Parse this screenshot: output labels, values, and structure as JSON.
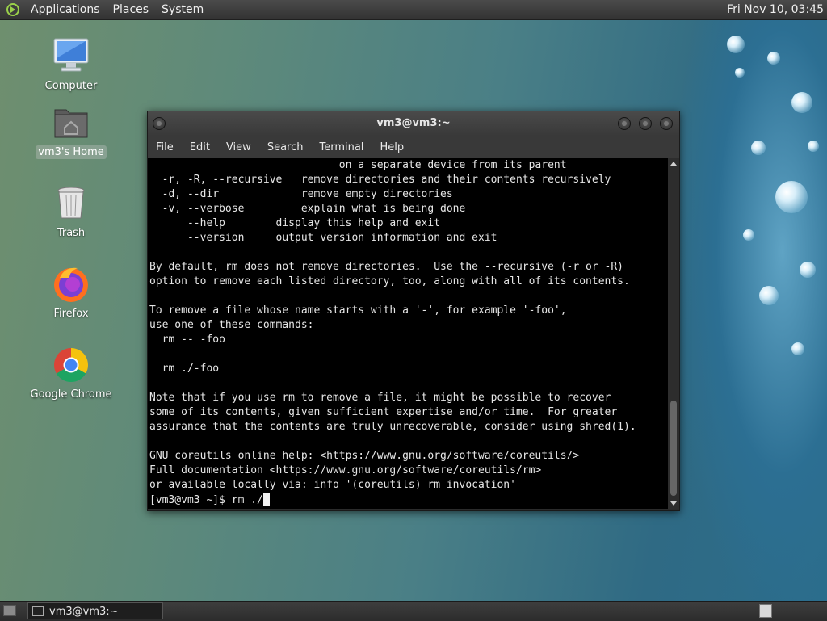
{
  "top_panel": {
    "menus": [
      "Applications",
      "Places",
      "System"
    ],
    "clock": "Fri Nov 10, 03:45"
  },
  "desktop_icons": [
    {
      "label": "Computer",
      "icon": "computer-icon"
    },
    {
      "label": "vm3's Home",
      "icon": "home-folder-icon"
    },
    {
      "label": "Trash",
      "icon": "trash-icon"
    },
    {
      "label": "Firefox",
      "icon": "firefox-icon"
    },
    {
      "label": "Google Chrome",
      "icon": "chrome-icon"
    }
  ],
  "terminal": {
    "title": "vm3@vm3:~",
    "menus": [
      "File",
      "Edit",
      "View",
      "Search",
      "Terminal",
      "Help"
    ],
    "lines": [
      "                              on a separate device from its parent",
      "  -r, -R, --recursive   remove directories and their contents recursively",
      "  -d, --dir             remove empty directories",
      "  -v, --verbose         explain what is being done",
      "      --help        display this help and exit",
      "      --version     output version information and exit",
      "",
      "By default, rm does not remove directories.  Use the --recursive (-r or -R)",
      "option to remove each listed directory, too, along with all of its contents.",
      "",
      "To remove a file whose name starts with a '-', for example '-foo',",
      "use one of these commands:",
      "  rm -- -foo",
      "",
      "  rm ./-foo",
      "",
      "Note that if you use rm to remove a file, it might be possible to recover",
      "some of its contents, given sufficient expertise and/or time.  For greater",
      "assurance that the contents are truly unrecoverable, consider using shred(1).",
      "",
      "GNU coreutils online help: <https://www.gnu.org/software/coreutils/>",
      "Full documentation <https://www.gnu.org/software/coreutils/rm>",
      "or available locally via: info '(coreutils) rm invocation'"
    ],
    "prompt": "[vm3@vm3 ~]$ rm ./"
  },
  "taskbar": {
    "task_label": "vm3@vm3:~"
  },
  "colors": {
    "terminal_bg": "#000000",
    "terminal_fg": "#e6e6e6",
    "panel_bg": "#3a3a3a"
  }
}
